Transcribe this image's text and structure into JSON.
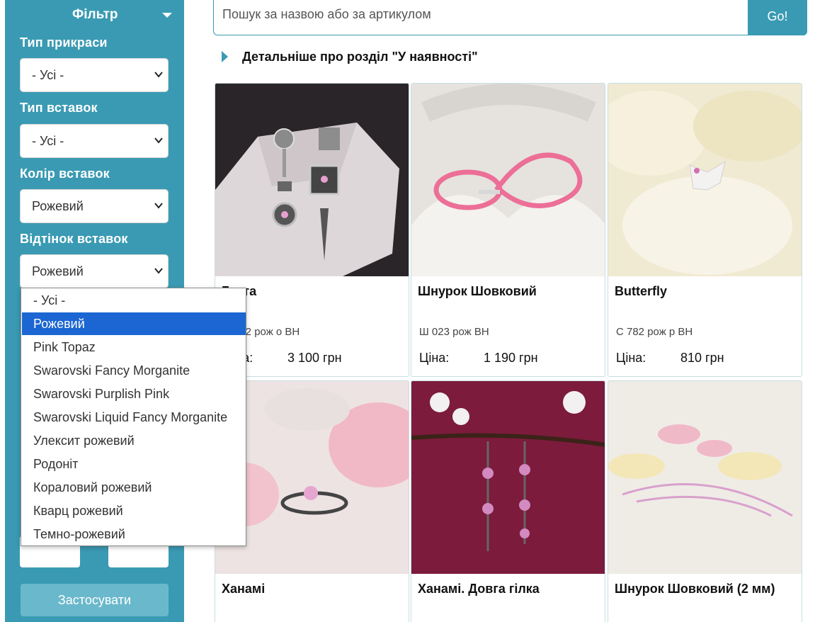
{
  "filter": {
    "title": "Фільтр",
    "type_label": "Тип прикраси",
    "type_value": "- Усі -",
    "insert_type_label": "Тип вставок",
    "insert_type_value": "- Усі -",
    "insert_color_label": "Колір вставок",
    "insert_color_value": "Рожевий",
    "insert_shade_label": "Відтінок вставок",
    "insert_shade_value": "Рожевий",
    "apply_label": "Застосувати"
  },
  "dropdown": {
    "options": [
      "- Усі -",
      "Рожевий",
      "Pink Topaz",
      "Swarovski Fancy Morganite",
      "Swarovski Purplish Pink",
      "Swarovski Liquid Fancy Morganite",
      "Улексит рожевий",
      "Родоніт",
      "Кораловий рожевий",
      "Кварц рожевий",
      "Темно-рожевий"
    ],
    "selected_index": 1
  },
  "search": {
    "placeholder": "Пошук за назвою або за артикулом",
    "button": "Go!"
  },
  "more_link": "Детальніше про розділ \"У наявності\"",
  "products": [
    {
      "name": "Грета",
      "sku": "С 742 рож о ВН",
      "price_label": "Ціна:",
      "price": "3 100 грн"
    },
    {
      "name": "Шнурок Шовковий",
      "sku": "Ш 023 рож ВН",
      "price_label": "Ціна:",
      "price": "1 190 грн"
    },
    {
      "name": "Butterfly",
      "sku": "С 782 рож р ВН",
      "price_label": "Ціна:",
      "price": "810 грн"
    },
    {
      "name": "Ханамі",
      "sku": "",
      "price_label": "",
      "price": ""
    },
    {
      "name": "Ханамі. Довга гілка",
      "sku": "",
      "price_label": "",
      "price": ""
    },
    {
      "name": "Шнурок Шовковий (2 мм)",
      "sku": "",
      "price_label": "",
      "price": ""
    }
  ],
  "colors": {
    "accent": "#3a9ab3",
    "selected": "#1b66d2",
    "apply": "#6ab8cb"
  }
}
